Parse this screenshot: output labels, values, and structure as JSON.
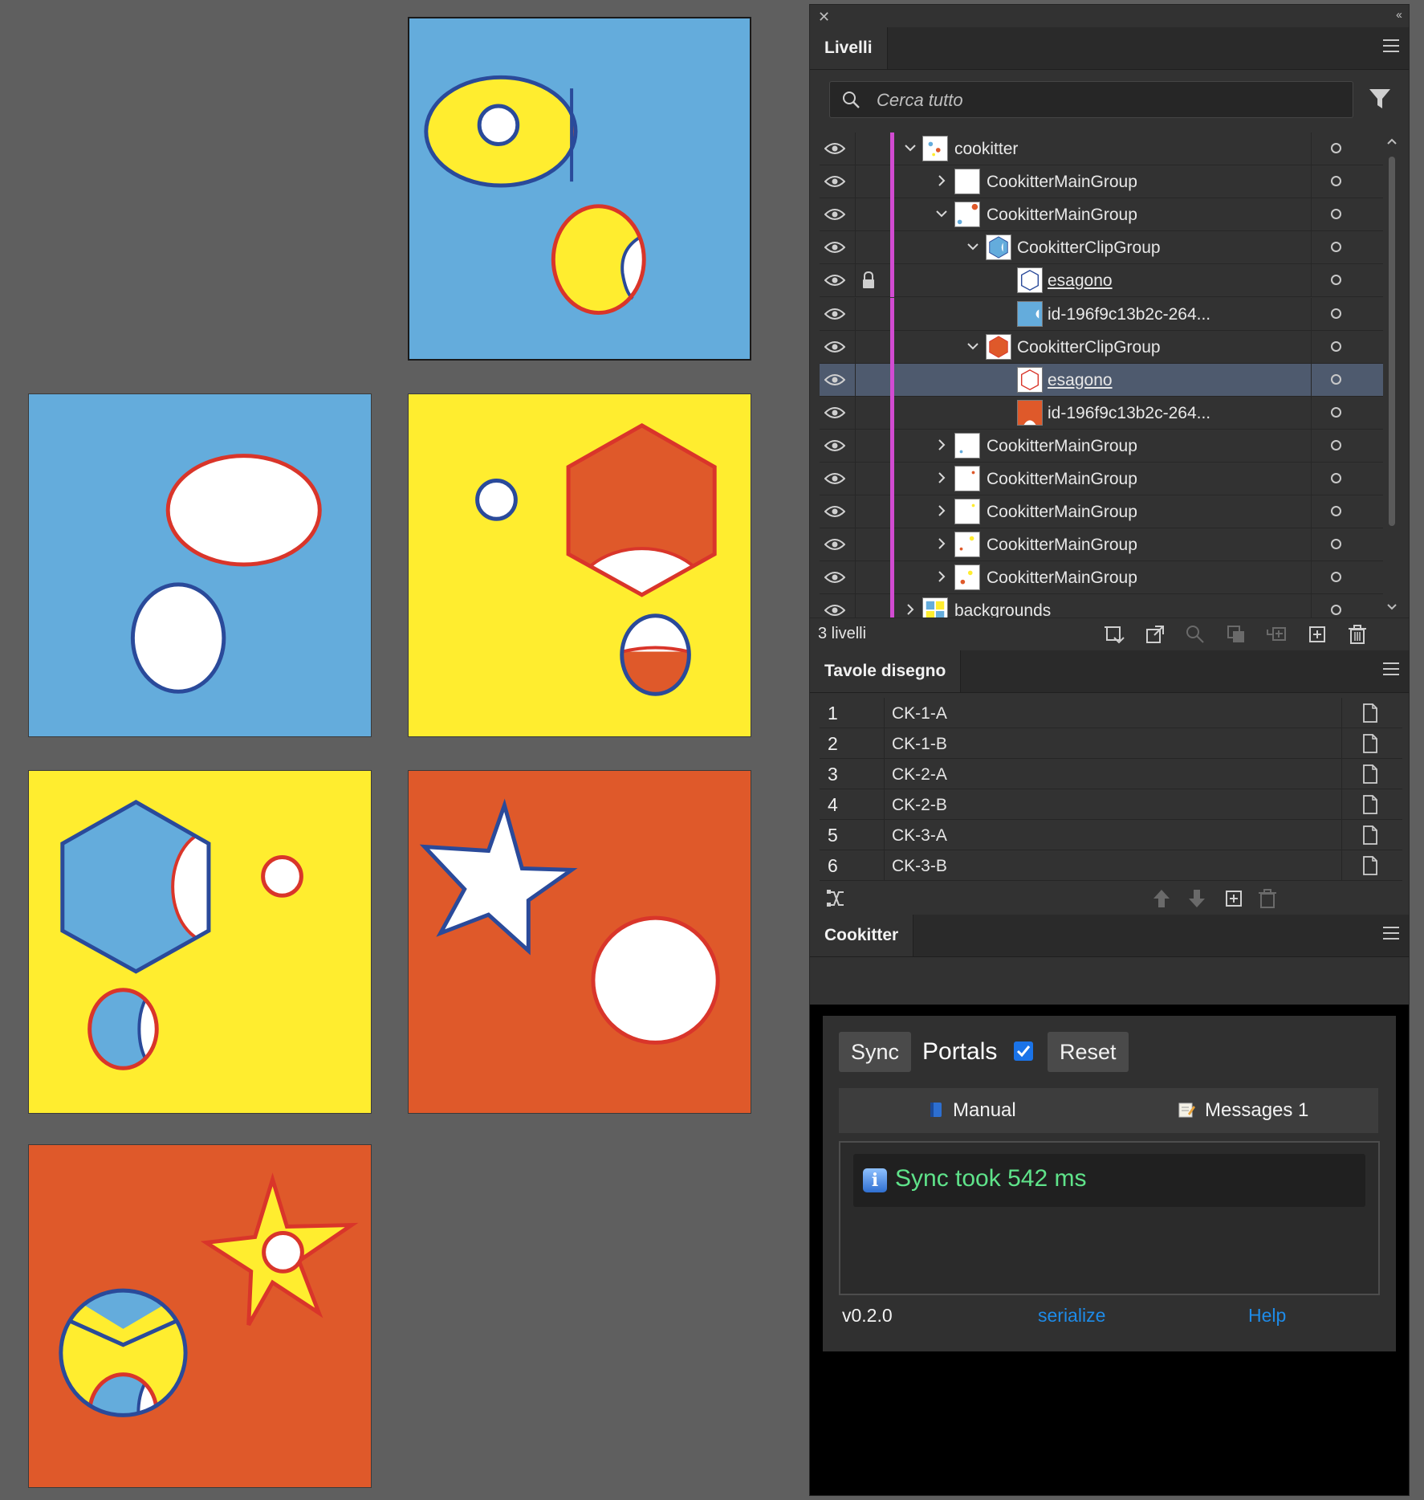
{
  "colors": {
    "blue": "#64acdc",
    "yellow": "#ffed2f",
    "orange": "#df592a",
    "white": "#ffffff",
    "outline_blue": "#2a4a9a",
    "outline_red": "#d9352a",
    "layer_color": "#d24bd2",
    "selected_row": "#4e5a6e",
    "success_text": "#5fe38a",
    "link_blue": "#1e8be8"
  },
  "layers_panel": {
    "tab_label": "Livelli",
    "search_placeholder": "Cerca tutto",
    "rows": [
      {
        "name": "cookitter",
        "indent": 0,
        "expanded": true,
        "locked": false,
        "selected": false,
        "underline": false
      },
      {
        "name": "CookitterMainGroup",
        "indent": 1,
        "expanded": false,
        "locked": false,
        "selected": false,
        "underline": false
      },
      {
        "name": "CookitterMainGroup",
        "indent": 1,
        "expanded": true,
        "locked": false,
        "selected": false,
        "underline": false
      },
      {
        "name": "CookitterClipGroup",
        "indent": 2,
        "expanded": true,
        "locked": false,
        "selected": false,
        "underline": false
      },
      {
        "name": "esagono",
        "indent": 3,
        "expanded": null,
        "locked": true,
        "selected": false,
        "underline": true
      },
      {
        "name": "id-196f9c13b2c-264...",
        "indent": 3,
        "expanded": null,
        "locked": false,
        "selected": false,
        "underline": false
      },
      {
        "name": "CookitterClipGroup",
        "indent": 2,
        "expanded": true,
        "locked": false,
        "selected": false,
        "underline": false
      },
      {
        "name": "esagono",
        "indent": 3,
        "expanded": null,
        "locked": false,
        "selected": true,
        "underline": true
      },
      {
        "name": "id-196f9c13b2c-264...",
        "indent": 3,
        "expanded": null,
        "locked": false,
        "selected": false,
        "underline": false
      },
      {
        "name": "CookitterMainGroup",
        "indent": 1,
        "expanded": false,
        "locked": false,
        "selected": false,
        "underline": false
      },
      {
        "name": "CookitterMainGroup",
        "indent": 1,
        "expanded": false,
        "locked": false,
        "selected": false,
        "underline": false
      },
      {
        "name": "CookitterMainGroup",
        "indent": 1,
        "expanded": false,
        "locked": false,
        "selected": false,
        "underline": false
      },
      {
        "name": "CookitterMainGroup",
        "indent": 1,
        "expanded": false,
        "locked": false,
        "selected": false,
        "underline": false
      },
      {
        "name": "CookitterMainGroup",
        "indent": 1,
        "expanded": false,
        "locked": false,
        "selected": false,
        "underline": false
      },
      {
        "name": "backgrounds",
        "indent": 0,
        "expanded": false,
        "locked": false,
        "selected": false,
        "underline": false
      }
    ],
    "footer_count": "3 livelli"
  },
  "artboards_panel": {
    "tab_label": "Tavole disegno",
    "rows": [
      {
        "num": "1",
        "name": "CK-1-A"
      },
      {
        "num": "2",
        "name": "CK-1-B"
      },
      {
        "num": "3",
        "name": "CK-2-A"
      },
      {
        "num": "4",
        "name": "CK-2-B"
      },
      {
        "num": "5",
        "name": "CK-3-A"
      },
      {
        "num": "6",
        "name": "CK-3-B"
      }
    ]
  },
  "cookitter_panel": {
    "tab_label": "Cookitter",
    "sync_label": "Sync",
    "portals_label": "Portals",
    "portals_checked": true,
    "reset_label": "Reset",
    "manual_tab": "Manual",
    "messages_tab": "Messages 1",
    "log_message": "Sync took 542 ms",
    "version": "v0.2.0",
    "serialize_link": "serialize",
    "help_link": "Help"
  }
}
